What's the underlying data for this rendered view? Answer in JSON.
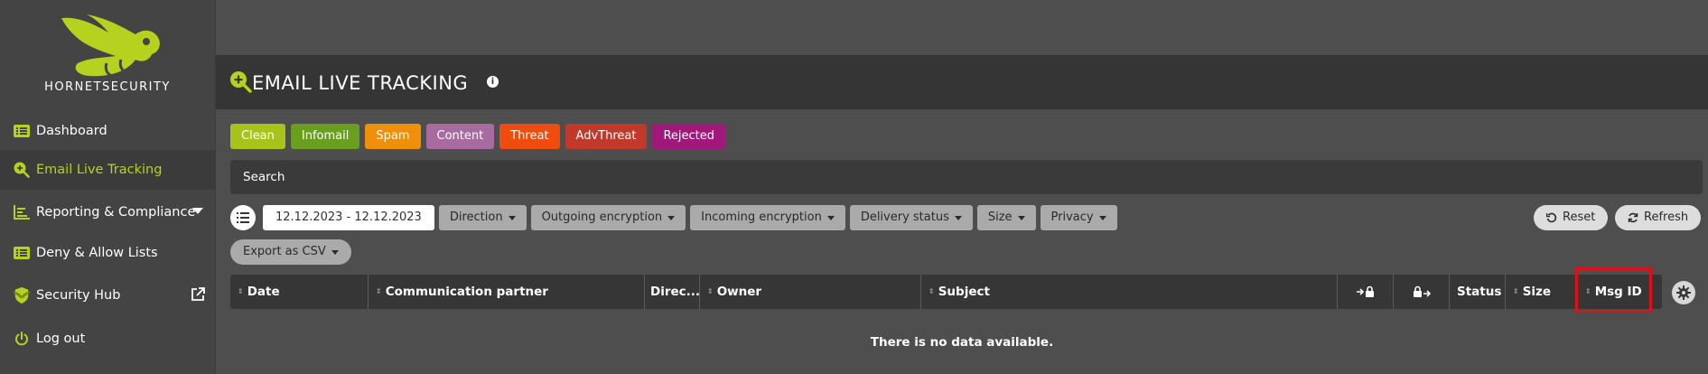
{
  "brand": {
    "name": "HORNETSECURITY",
    "accent": "#b6d21e"
  },
  "sidebar": {
    "items": [
      {
        "label": "Dashboard",
        "icon": "list-icon"
      },
      {
        "label": "Email Live Tracking",
        "icon": "search-plus-icon",
        "active": true
      },
      {
        "label": "Reporting & Compliance",
        "icon": "chart-icon",
        "expandable": true
      },
      {
        "label": "Deny & Allow Lists",
        "icon": "list-icon"
      },
      {
        "label": "Security Hub",
        "icon": "shield-icon",
        "external": true
      },
      {
        "label": "Log out",
        "icon": "power-icon"
      }
    ]
  },
  "page": {
    "title": "EMAIL LIVE TRACKING",
    "info": "i"
  },
  "filters": [
    {
      "label": "Clean",
      "color": "#a8c41b"
    },
    {
      "label": "Infomail",
      "color": "#6a9e1f"
    },
    {
      "label": "Spam",
      "color": "#f0900a"
    },
    {
      "label": "Content",
      "color": "#a86b9f"
    },
    {
      "label": "Threat",
      "color": "#f04c10"
    },
    {
      "label": "AdvThreat",
      "color": "#c0392b"
    },
    {
      "label": "Rejected",
      "color": "#a0197a"
    }
  ],
  "search": {
    "placeholder": "Search"
  },
  "toolbar": {
    "date_range": "12.12.2023 - 12.12.2023",
    "dropdowns": [
      "Direction",
      "Outgoing encryption",
      "Incoming encryption",
      "Delivery status",
      "Size",
      "Privacy"
    ],
    "export": "Export as CSV",
    "reset": "Reset",
    "refresh": "Refresh"
  },
  "table": {
    "columns": [
      "Date",
      "Communication partner",
      "Direc...",
      "Owner",
      "Subject",
      "",
      "",
      "Status",
      "Size",
      "Msg ID"
    ],
    "empty_message": "There is no data available."
  }
}
